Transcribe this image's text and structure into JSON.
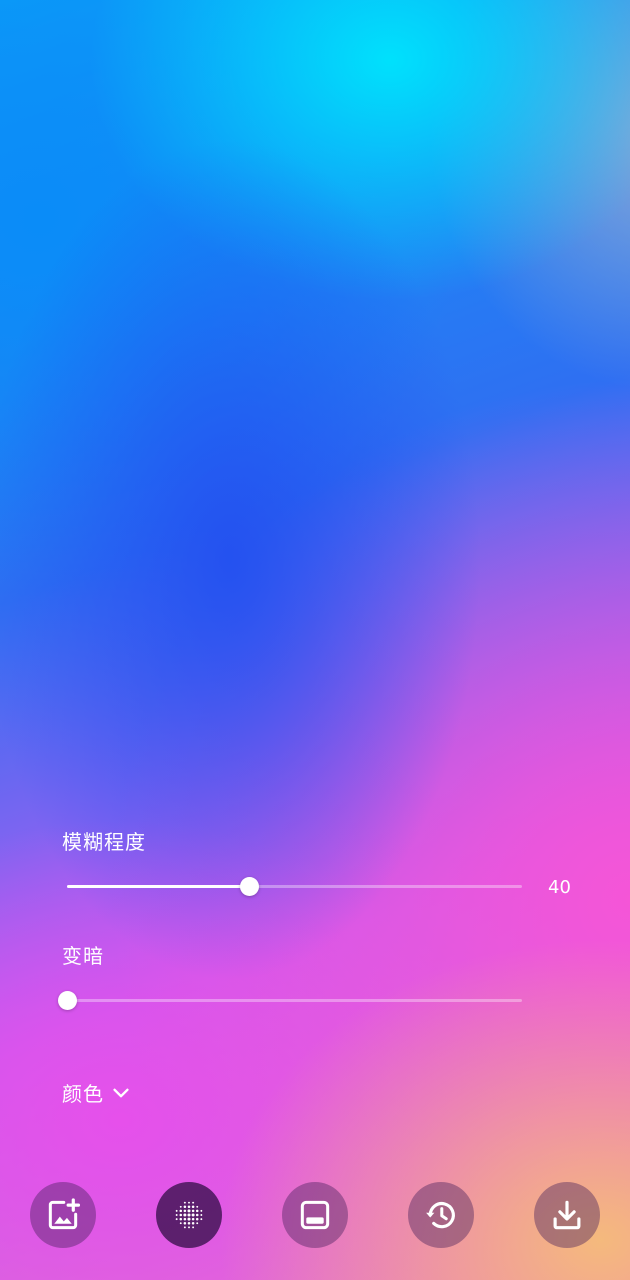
{
  "controls": {
    "blur": {
      "label": "模糊程度",
      "value": 40,
      "value_text": "40",
      "fraction": 0.4
    },
    "darken": {
      "label": "变暗",
      "fraction": 0.0
    },
    "color": {
      "label": "颜色",
      "expanded": false
    }
  },
  "toolbar": {
    "buttons": [
      {
        "icon": "add-image-icon",
        "active": false
      },
      {
        "icon": "blur-dots-icon",
        "active": true
      },
      {
        "icon": "bottom-panel-icon",
        "active": false
      },
      {
        "icon": "history-icon",
        "active": false
      },
      {
        "icon": "download-icon",
        "active": false
      }
    ]
  },
  "colors": {
    "accent": "#ffffff",
    "button_bg": "#461e5a",
    "button_active_bg": "#370f4b"
  }
}
